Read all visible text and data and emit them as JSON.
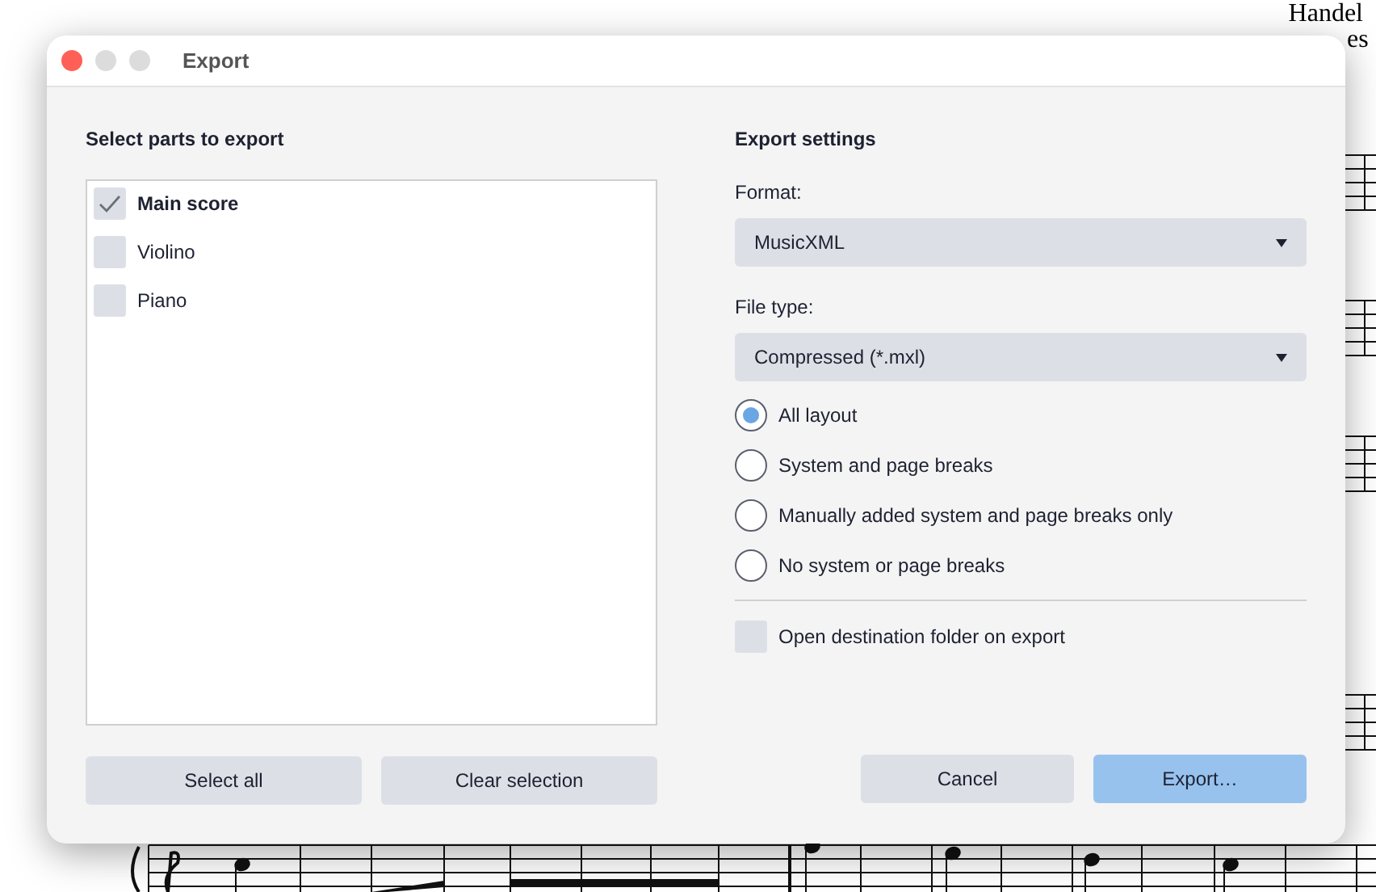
{
  "background": {
    "composer": "Handel",
    "subtitle_fragment": "es"
  },
  "window": {
    "title": "Export"
  },
  "parts": {
    "heading": "Select parts to export",
    "items": [
      {
        "label": "Main score",
        "checked": true
      },
      {
        "label": "Violino",
        "checked": false
      },
      {
        "label": "Piano",
        "checked": false
      }
    ],
    "buttons": [
      {
        "label": "Select all"
      },
      {
        "label": "Clear selection"
      }
    ]
  },
  "settings": {
    "heading": "Export settings",
    "format": {
      "label": "Format:",
      "value": "MusicXML"
    },
    "file_type": {
      "label": "File type:",
      "value": "Compressed (*.mxl)"
    },
    "layout_options": [
      {
        "label": "All layout",
        "selected": true
      },
      {
        "label": "System and page breaks",
        "selected": false
      },
      {
        "label": "Manually added system and page breaks only",
        "selected": false
      },
      {
        "label": "No system or page breaks",
        "selected": false
      }
    ],
    "open_folder": {
      "label": "Open destination folder on export",
      "checked": false
    }
  },
  "buttons": [
    {
      "label": "Cancel",
      "kind": "secondary"
    },
    {
      "label": "Export…",
      "kind": "primary"
    }
  ]
}
